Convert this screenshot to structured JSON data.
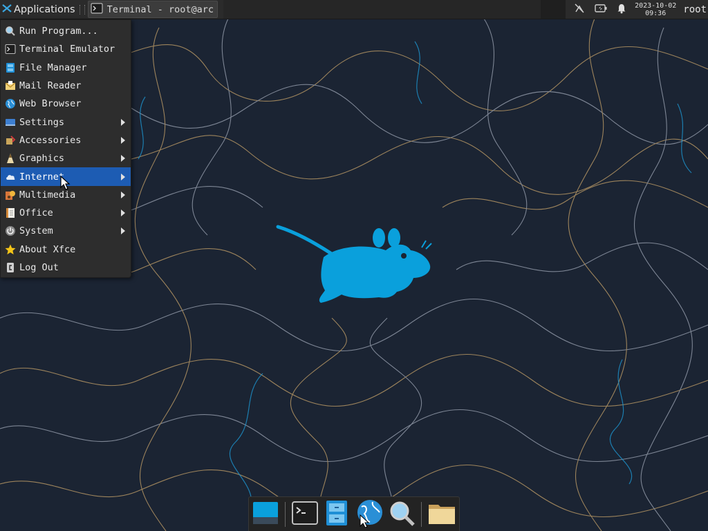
{
  "top_panel": {
    "applications_label": "Applications",
    "task_label": "Terminal - root@arch…",
    "clock_date": "2023-10-02",
    "clock_time": "09:36",
    "user_label": "root"
  },
  "menu": {
    "items": [
      {
        "label": "Run Program...",
        "icon": "search-icon",
        "submenu": false
      },
      {
        "label": "Terminal Emulator",
        "icon": "terminal-icon",
        "submenu": false
      },
      {
        "label": "File Manager",
        "icon": "file-manager-icon",
        "submenu": false
      },
      {
        "label": "Mail Reader",
        "icon": "mail-icon",
        "submenu": false
      },
      {
        "label": "Web Browser",
        "icon": "globe-icon",
        "submenu": false
      },
      {
        "label": "Settings",
        "icon": "settings-icon",
        "submenu": true
      },
      {
        "label": "Accessories",
        "icon": "accessories-icon",
        "submenu": true
      },
      {
        "label": "Graphics",
        "icon": "graphics-icon",
        "submenu": true
      },
      {
        "label": "Internet",
        "icon": "cloud-icon",
        "submenu": true,
        "active": true
      },
      {
        "label": "Multimedia",
        "icon": "multimedia-icon",
        "submenu": true
      },
      {
        "label": "Office",
        "icon": "office-icon",
        "submenu": true
      },
      {
        "label": "System",
        "icon": "power-icon",
        "submenu": true
      },
      {
        "label": "About Xfce",
        "icon": "star-icon",
        "submenu": false
      },
      {
        "label": "Log Out",
        "icon": "logout-icon",
        "submenu": false
      }
    ]
  },
  "dock": {
    "items": [
      {
        "icon": "show-desktop-icon"
      },
      {
        "icon": "terminal-icon"
      },
      {
        "icon": "file-manager-icon"
      },
      {
        "icon": "web-browser-icon"
      },
      {
        "icon": "app-finder-icon"
      },
      {
        "icon": "folder-icon"
      }
    ]
  },
  "colors": {
    "accent": "#1d5cb3",
    "desktop_bg": "#1b2433",
    "mascot": "#0aa0dc"
  }
}
